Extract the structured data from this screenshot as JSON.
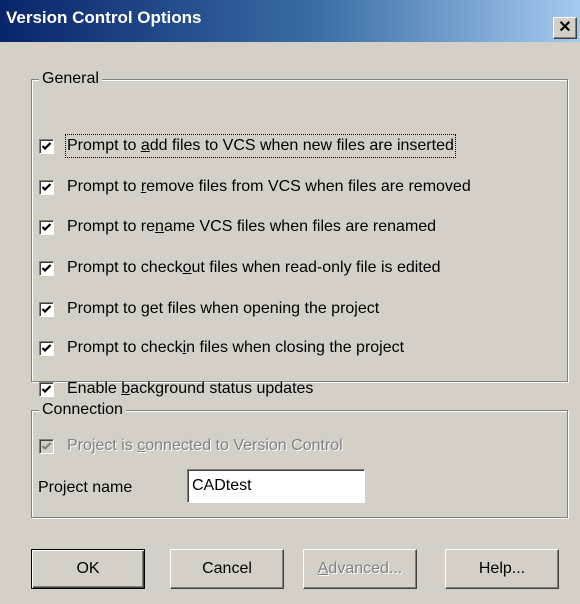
{
  "window": {
    "title": "Version Control Options",
    "close_glyph": "✕"
  },
  "general": {
    "legend": "General",
    "options": [
      {
        "pre": "Prompt to ",
        "mnemonic": "a",
        "post": "dd files to VCS when new files are inserted",
        "checked": true,
        "enabled": true,
        "focused": true
      },
      {
        "pre": "Prompt to ",
        "mnemonic": "r",
        "post": "emove files from VCS when files are removed",
        "checked": true,
        "enabled": true
      },
      {
        "pre": "Prompt to re",
        "mnemonic": "n",
        "post": "ame VCS files when files are renamed",
        "checked": true,
        "enabled": true
      },
      {
        "pre": "Prompt to check",
        "mnemonic": "o",
        "post": "ut files when read-only file is edited",
        "checked": true,
        "enabled": true
      },
      {
        "pre": "Prompt to ",
        "mnemonic": "g",
        "post": "et files when opening the project",
        "checked": true,
        "enabled": true
      },
      {
        "pre": "Prompt to check",
        "mnemonic": "i",
        "post": "n files when closing the project",
        "checked": true,
        "enabled": true
      },
      {
        "pre": "Enable ",
        "mnemonic": "b",
        "post": "ackground status updates",
        "checked": true,
        "enabled": true
      }
    ]
  },
  "connection": {
    "legend": "Connection",
    "connected": {
      "pre": "Project is ",
      "mnemonic": "c",
      "post": "onnected to Version Control",
      "checked": true,
      "enabled": false
    },
    "project_name_label": "Project name",
    "project_name_value": "CADtest"
  },
  "buttons": {
    "ok": "OK",
    "cancel": "Cancel",
    "advanced": "Advanced...",
    "help": "Help..."
  },
  "icons": [
    "close-icon",
    "checkmark-icon"
  ],
  "colors": {
    "face": "#d4d0c8",
    "title_start": "#0a246a",
    "title_end": "#a6caf0",
    "disabled_text": "#808080"
  }
}
